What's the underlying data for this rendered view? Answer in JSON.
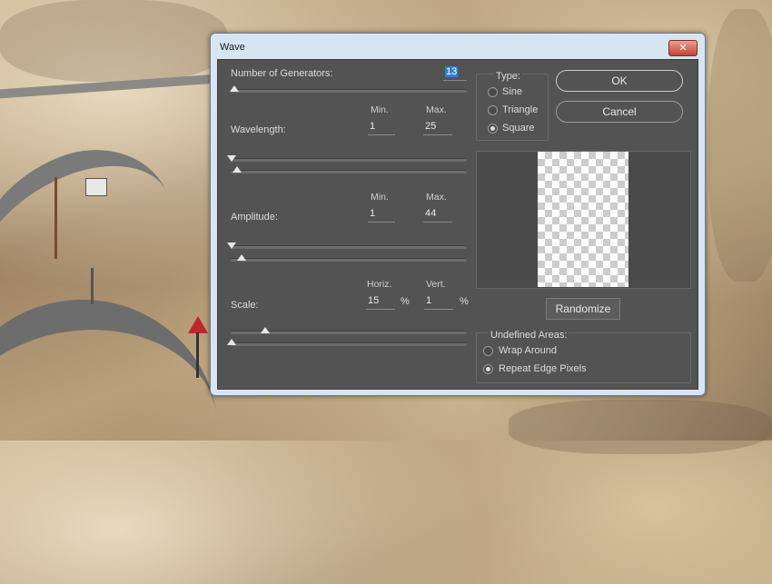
{
  "dialog": {
    "title": "Wave",
    "close_label": "✕"
  },
  "generators": {
    "label": "Number of Generators:",
    "value": "13"
  },
  "wavelength": {
    "label": "Wavelength:",
    "min_header": "Min.",
    "max_header": "Max.",
    "min": "1",
    "max": "25"
  },
  "amplitude": {
    "label": "Amplitude:",
    "min_header": "Min.",
    "max_header": "Max.",
    "min": "1",
    "max": "44"
  },
  "scale": {
    "label": "Scale:",
    "horiz_header": "Horiz.",
    "vert_header": "Vert.",
    "horiz": "15",
    "vert": "1",
    "unit": "%"
  },
  "type": {
    "label": "Type:",
    "options": [
      "Sine",
      "Triangle",
      "Square"
    ],
    "selected": "Square"
  },
  "buttons": {
    "ok": "OK",
    "cancel": "Cancel",
    "randomize": "Randomize"
  },
  "undefined_areas": {
    "label": "Undefined Areas:",
    "options": [
      "Wrap Around",
      "Repeat Edge Pixels"
    ],
    "selected": "Repeat Edge Pixels"
  }
}
